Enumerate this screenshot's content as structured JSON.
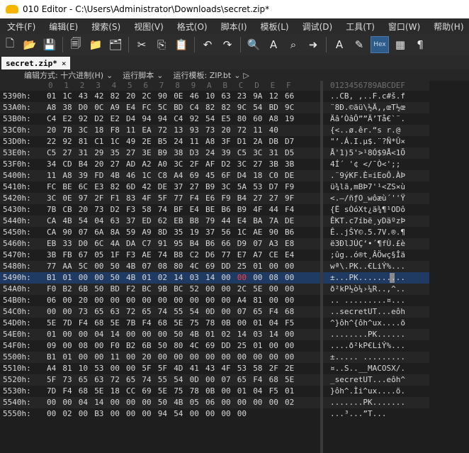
{
  "window": {
    "title": "010 Editor - C:\\Users\\Administrator\\Downloads\\secret.zip*"
  },
  "menu": [
    "文件(F)",
    "编辑(E)",
    "搜索(S)",
    "视图(V)",
    "格式(O)",
    "脚本(I)",
    "模板(L)",
    "调试(D)",
    "工具(T)",
    "窗口(W)",
    "帮助(H)"
  ],
  "toolbar": {
    "icons": [
      "new-file-icon",
      "open-folder-icon",
      "save-icon",
      "save-all-icon",
      "open-icon",
      "folders-icon",
      "cut-icon",
      "copy-icon",
      "paste-icon",
      "undo-icon",
      "redo-icon",
      "find-icon",
      "find-replace-icon",
      "goto-icon",
      "arrow-right-icon",
      "font-icon",
      "highlight-icon"
    ],
    "hex_label": "Hex"
  },
  "tab": {
    "label": "secret.zip*",
    "close": "×"
  },
  "subbar": {
    "encoding": "编辑方式: 十六进制(H)",
    "script": "运行脚本",
    "template": "运行模板: ZIP.bt"
  },
  "columns": {
    "hex": [
      "0",
      "1",
      "2",
      "3",
      "4",
      "5",
      "6",
      "7",
      "8",
      "9",
      "A",
      "B",
      "C",
      "D",
      "E",
      "F"
    ],
    "ascii": "0123456789ABCDEF"
  },
  "rows": [
    {
      "addr": "5390h:",
      "bytes": [
        "01",
        "1C",
        "43",
        "42",
        "82",
        "20",
        "2C",
        "90",
        "0E",
        "46",
        "10",
        "63",
        "23",
        "9A",
        "12",
        "66"
      ],
      "ascii": "..CB, ,..F.c#š.f"
    },
    {
      "addr": "53A0h:",
      "bytes": [
        "A8",
        "38",
        "D0",
        "0C",
        "A9",
        "E4",
        "FC",
        "5C",
        "BD",
        "C4",
        "82",
        "82",
        "9C",
        "54",
        "BD",
        "9C"
      ],
      "ascii": "¨8Ð.©äü\\½Ä‚‚œT½œ"
    },
    {
      "addr": "53B0h:",
      "bytes": [
        "C4",
        "E2",
        "92",
        "D2",
        "E2",
        "D4",
        "94",
        "94",
        "C4",
        "92",
        "54",
        "E5",
        "80",
        "60",
        "A8",
        "19"
      ],
      "ascii": "Äâ’ÒâÔ””Ä’Tå€`¨."
    },
    {
      "addr": "53C0h:",
      "bytes": [
        "20",
        "7B",
        "3C",
        "18",
        "F8",
        "11",
        "EA",
        "72",
        "13",
        "93",
        "73",
        "20",
        "72",
        "11",
        "40",
        " "
      ],
      "ascii": " {<..ø.êr.“s r.@"
    },
    {
      "addr": "53D0h:",
      "bytes": [
        "22",
        "92",
        "81",
        "C1",
        "1C",
        "49",
        "2E",
        "B5",
        "24",
        "11",
        "A8",
        "3F",
        "D1",
        "2A",
        "DB",
        "D7"
      ],
      "ascii": "\"’.Á.I.µ$.¨?Ñ*Û×"
    },
    {
      "addr": "53E0h:",
      "bytes": [
        "C5",
        "27",
        "31",
        "29",
        "35",
        "27",
        "3E",
        "B9",
        "38",
        "D3",
        "24",
        "39",
        "C5",
        "3C",
        "31",
        "D5"
      ],
      "ascii": "Å'1)5'>¹8Ó$9Å<1Õ"
    },
    {
      "addr": "53F0h:",
      "bytes": [
        "34",
        "CD",
        "B4",
        "20",
        "27",
        "AD",
        "A2",
        "A0",
        "3C",
        "2F",
        "AF",
        "D2",
        "3C",
        "27",
        "3B",
        "3B"
      ],
      "ascii": "4Í´ '­¢ </¯Ò<';;"
    },
    {
      "addr": "5400h:",
      "bytes": [
        "11",
        "A8",
        "39",
        "FD",
        "4B",
        "46",
        "1C",
        "C8",
        "A4",
        "69",
        "45",
        "6F",
        "D4",
        "18",
        "C0",
        "DE"
      ],
      "ascii": ".¨9ýKF.È¤iEoÔ.ÀÞ"
    },
    {
      "addr": "5410h:",
      "bytes": [
        "FC",
        "BE",
        "6C",
        "E3",
        "82",
        "6D",
        "42",
        "DE",
        "37",
        "27",
        "B9",
        "3C",
        "5A",
        "53",
        "D7",
        "F9"
      ],
      "ascii": "ü¾lã‚mBÞ7'¹<ZS×ù"
    },
    {
      "addr": "5420h:",
      "bytes": [
        "3C",
        "0E",
        "97",
        "2F",
        "F1",
        "83",
        "4F",
        "5F",
        "77",
        "F4",
        "E6",
        "F9",
        "B4",
        "27",
        "27",
        "9F"
      ],
      "ascii": "<.—/ñƒO_wôæù´''Ÿ"
    },
    {
      "addr": "5430h:",
      "bytes": [
        "7B",
        "CB",
        "20",
        "73",
        "D2",
        "F3",
        "58",
        "74",
        "BF",
        "E4",
        "BE",
        "B6",
        "B9",
        "4F",
        "44",
        "F4"
      ],
      "ascii": "{Ë sÒóXt¿ä¾¶¹ODô"
    },
    {
      "addr": "5440h:",
      "bytes": [
        "CA",
        "4B",
        "54",
        "04",
        "63",
        "37",
        "ED",
        "62",
        "EB",
        "B8",
        "79",
        "44",
        "E4",
        "BA",
        "7A",
        "DE"
      ],
      "ascii": "ÊKT.c7íbë¸yDäºzÞ"
    },
    {
      "addr": "5450h:",
      "bytes": [
        "CA",
        "90",
        "07",
        "6A",
        "8A",
        "59",
        "A9",
        "8D",
        "35",
        "19",
        "37",
        "56",
        "1C",
        "AE",
        "90",
        "B6"
      ],
      "ascii": "Ê..jŠY©.5.7V.®.¶"
    },
    {
      "addr": "5460h:",
      "bytes": [
        "EB",
        "33",
        "D0",
        "6C",
        "4A",
        "DA",
        "C7",
        "91",
        "95",
        "B4",
        "B6",
        "66",
        "D9",
        "07",
        "A3",
        "E8"
      ],
      "ascii": "ë3ÐlJÚÇ‘•´¶fÙ.£è"
    },
    {
      "addr": "5470h:",
      "bytes": [
        "3B",
        "FB",
        "67",
        "05",
        "1F",
        "F3",
        "AE",
        "74",
        "B8",
        "C2",
        "D6",
        "77",
        "E7",
        "A7",
        "CE",
        "E4"
      ],
      "ascii": ";ûg..ó®t¸ÂÖwç§Îä"
    },
    {
      "addr": "5480h:",
      "bytes": [
        "77",
        "AA",
        "5C",
        "00",
        "50",
        "4B",
        "07",
        "08",
        "80",
        "4C",
        "69",
        "DD",
        "25",
        "01",
        "00",
        "00"
      ],
      "ascii": "wª\\.PK..€LiÝ%..."
    },
    {
      "addr": "5490h:",
      "bytes": [
        "B1",
        "01",
        "00",
        "00",
        "50",
        "4B",
        "01",
        "02",
        "14",
        "03",
        "14",
        "00",
        "00",
        "00",
        "08",
        "00"
      ],
      "ascii": "±...PK.........."
    },
    {
      "addr": "54A0h:",
      "bytes": [
        "F0",
        "B2",
        "6B",
        "50",
        "BD",
        "F2",
        "BC",
        "9B",
        "BC",
        "52",
        "00",
        "00",
        "2C",
        "5E",
        "00",
        "00"
      ],
      "ascii": "ð²kP½ò¼›¼R..,^.."
    },
    {
      "addr": "54B0h:",
      "bytes": [
        "06",
        "00",
        "20",
        "00",
        "00",
        "00",
        "00",
        "00",
        "00",
        "00",
        "00",
        "00",
        "A4",
        "81",
        "00",
        "00"
      ],
      "ascii": ".. .........¤..."
    },
    {
      "addr": "54C0h:",
      "bytes": [
        "00",
        "00",
        "73",
        "65",
        "63",
        "72",
        "65",
        "74",
        "55",
        "54",
        "0D",
        "00",
        "07",
        "65",
        "F4",
        "68"
      ],
      "ascii": "..secretUT...eôh"
    },
    {
      "addr": "54D0h:",
      "bytes": [
        "5E",
        "7D",
        "F4",
        "68",
        "5E",
        "7B",
        "F4",
        "68",
        "5E",
        "75",
        "78",
        "0B",
        "00",
        "01",
        "04",
        "F5"
      ],
      "ascii": "^}ôh^{ôh^ux....õ"
    },
    {
      "addr": "54E0h:",
      "bytes": [
        "01",
        "00",
        "00",
        "04",
        "14",
        "00",
        "00",
        "00",
        "50",
        "4B",
        "01",
        "02",
        "14",
        "03",
        "14",
        "00"
      ],
      "ascii": "........PK......"
    },
    {
      "addr": "54F0h:",
      "bytes": [
        "09",
        "00",
        "08",
        "00",
        "F0",
        "B2",
        "6B",
        "50",
        "80",
        "4C",
        "69",
        "DD",
        "25",
        "01",
        "00",
        "00"
      ],
      "ascii": "....ð²kP€LiÝ%..."
    },
    {
      "addr": "5500h:",
      "bytes": [
        "B1",
        "01",
        "00",
        "00",
        "11",
        "00",
        "20",
        "00",
        "00",
        "00",
        "00",
        "00",
        "00",
        "00",
        "00",
        "00"
      ],
      "ascii": "±..... ........."
    },
    {
      "addr": "5510h:",
      "bytes": [
        "A4",
        "81",
        "10",
        "53",
        "00",
        "00",
        "5F",
        "5F",
        "4D",
        "41",
        "43",
        "4F",
        "53",
        "58",
        "2F",
        "2E"
      ],
      "ascii": "¤..S..__MACOSX/."
    },
    {
      "addr": "5520h:",
      "bytes": [
        "5F",
        "73",
        "65",
        "63",
        "72",
        "65",
        "74",
        "55",
        "54",
        "0D",
        "00",
        "07",
        "65",
        "F4",
        "68",
        "5E"
      ],
      "ascii": "_secretUT...eôh^"
    },
    {
      "addr": "5530h:",
      "bytes": [
        "7D",
        "F4",
        "68",
        "5E",
        "18",
        "CC",
        "69",
        "5E",
        "75",
        "78",
        "0B",
        "00",
        "01",
        "04",
        "F5",
        "01"
      ],
      "ascii": "}ôh^.Ìi^ux....õ."
    },
    {
      "addr": "5540h:",
      "bytes": [
        "00",
        "00",
        "04",
        "14",
        "00",
        "00",
        "00",
        "50",
        "4B",
        "05",
        "06",
        "00",
        "00",
        "00",
        "00",
        "02"
      ],
      "ascii": ".......PK......."
    },
    {
      "addr": "5550h:",
      "bytes": [
        "00",
        "02",
        "00",
        "B3",
        "00",
        "00",
        "00",
        "94",
        "54",
        "00",
        "00",
        "00",
        "00",
        " ",
        " ",
        " "
      ],
      "ascii": "...³...”T..."
    }
  ],
  "colors": {
    "selected_row": "#1f3b63",
    "changed_byte": "#ff4040"
  }
}
